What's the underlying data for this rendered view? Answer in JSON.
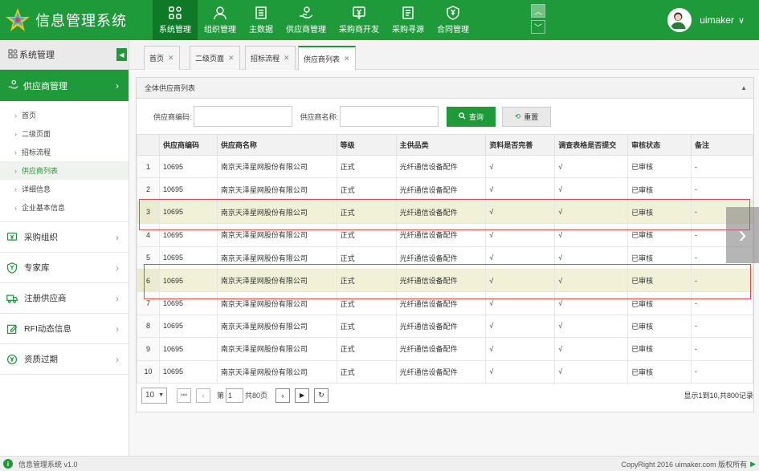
{
  "app": {
    "title": "信息管理系统",
    "version_text": "信息管理系统 v1.0",
    "copyright": "CopyRight 2016  uimaker.com 版权所有"
  },
  "colors": {
    "primary": "#1e9a3a",
    "primary_dark": "#0e7a27",
    "highlight_row": "#f1f1d7",
    "red_box": "#e04b4b"
  },
  "nav": [
    {
      "label": "系统管理",
      "icon": "grid-icon",
      "active": true
    },
    {
      "label": "组织管理",
      "icon": "user-icon"
    },
    {
      "label": "主数据",
      "icon": "document-icon"
    },
    {
      "label": "供应商管理",
      "icon": "hand-coin-icon"
    },
    {
      "label": "采购商开发",
      "icon": "yen-chat-icon"
    },
    {
      "label": "采购寻源",
      "icon": "list-doc-icon"
    },
    {
      "label": "合同管理",
      "icon": "yen-shield-icon"
    }
  ],
  "user": {
    "name": "uimaker"
  },
  "sidebar": {
    "header": "系统管理",
    "group": "供应商管理",
    "sub_items": [
      "首页",
      "二级页面",
      "招标流程",
      "供应商列表",
      "详细信息",
      "企业基本信息"
    ],
    "menus": [
      {
        "label": "采购组织",
        "icon": "yen-chat-icon"
      },
      {
        "label": "专家库",
        "icon": "shield-yen-icon"
      },
      {
        "label": "注册供应商",
        "icon": "truck-icon"
      },
      {
        "label": "RFI动态信息",
        "icon": "edit-icon"
      },
      {
        "label": "资质过期",
        "icon": "badge-yen-icon"
      }
    ]
  },
  "tabs": [
    "首页",
    "二级页面",
    "招标流程",
    "供应商列表"
  ],
  "panel": {
    "title": "全体供应商列表"
  },
  "search": {
    "code_label": "供应商编码:",
    "name_label": "供应商名称:",
    "query_label": "查询",
    "reset_label": "重置"
  },
  "table": {
    "headers": [
      "",
      "供应商编码",
      "供应商名称",
      "等级",
      "主供品类",
      "资料是否完善",
      "调查表格是否提交",
      "审核状态",
      "备注"
    ],
    "rows": [
      [
        "1",
        "10695",
        "南京天泽星网股份有限公司",
        "正式",
        "光纤通信设备配件",
        "√",
        "√",
        "已审核",
        "-"
      ],
      [
        "2",
        "10695",
        "南京天泽星网股份有限公司",
        "正式",
        "光纤通信设备配件",
        "√",
        "√",
        "已审核",
        "-"
      ],
      [
        "3",
        "10695",
        "南京天泽星网股份有限公司",
        "正式",
        "光纤通信设备配件",
        "√",
        "√",
        "已审核",
        "-"
      ],
      [
        "4",
        "10695",
        "南京天泽星网股份有限公司",
        "正式",
        "光纤通信设备配件",
        "√",
        "√",
        "已审核",
        "-"
      ],
      [
        "5",
        "10695",
        "南京天泽星网股份有限公司",
        "正式",
        "光纤通信设备配件",
        "√",
        "√",
        "已审核",
        "-"
      ],
      [
        "6",
        "10695",
        "南京天泽星网股份有限公司",
        "正式",
        "光纤通信设备配件",
        "√",
        "√",
        "已审核",
        "-"
      ],
      [
        "7",
        "10695",
        "南京天泽星网股份有限公司",
        "正式",
        "光纤通信设备配件",
        "√",
        "√",
        "已审核",
        "-"
      ],
      [
        "8",
        "10695",
        "南京天泽星网股份有限公司",
        "正式",
        "光纤通信设备配件",
        "√",
        "√",
        "已审核",
        "-"
      ],
      [
        "9",
        "10695",
        "南京天泽星网股份有限公司",
        "正式",
        "光纤通信设备配件",
        "√",
        "√",
        "已审核",
        "-"
      ],
      [
        "10",
        "10695",
        "南京天泽星网股份有限公司",
        "正式",
        "光纤通信设备配件",
        "√",
        "√",
        "已审核",
        "-"
      ]
    ]
  },
  "pager": {
    "page_size": "10",
    "page_prefix": "第",
    "page_value": "1",
    "total_pages": "共80页",
    "info": "显示1到10,共800记录"
  }
}
